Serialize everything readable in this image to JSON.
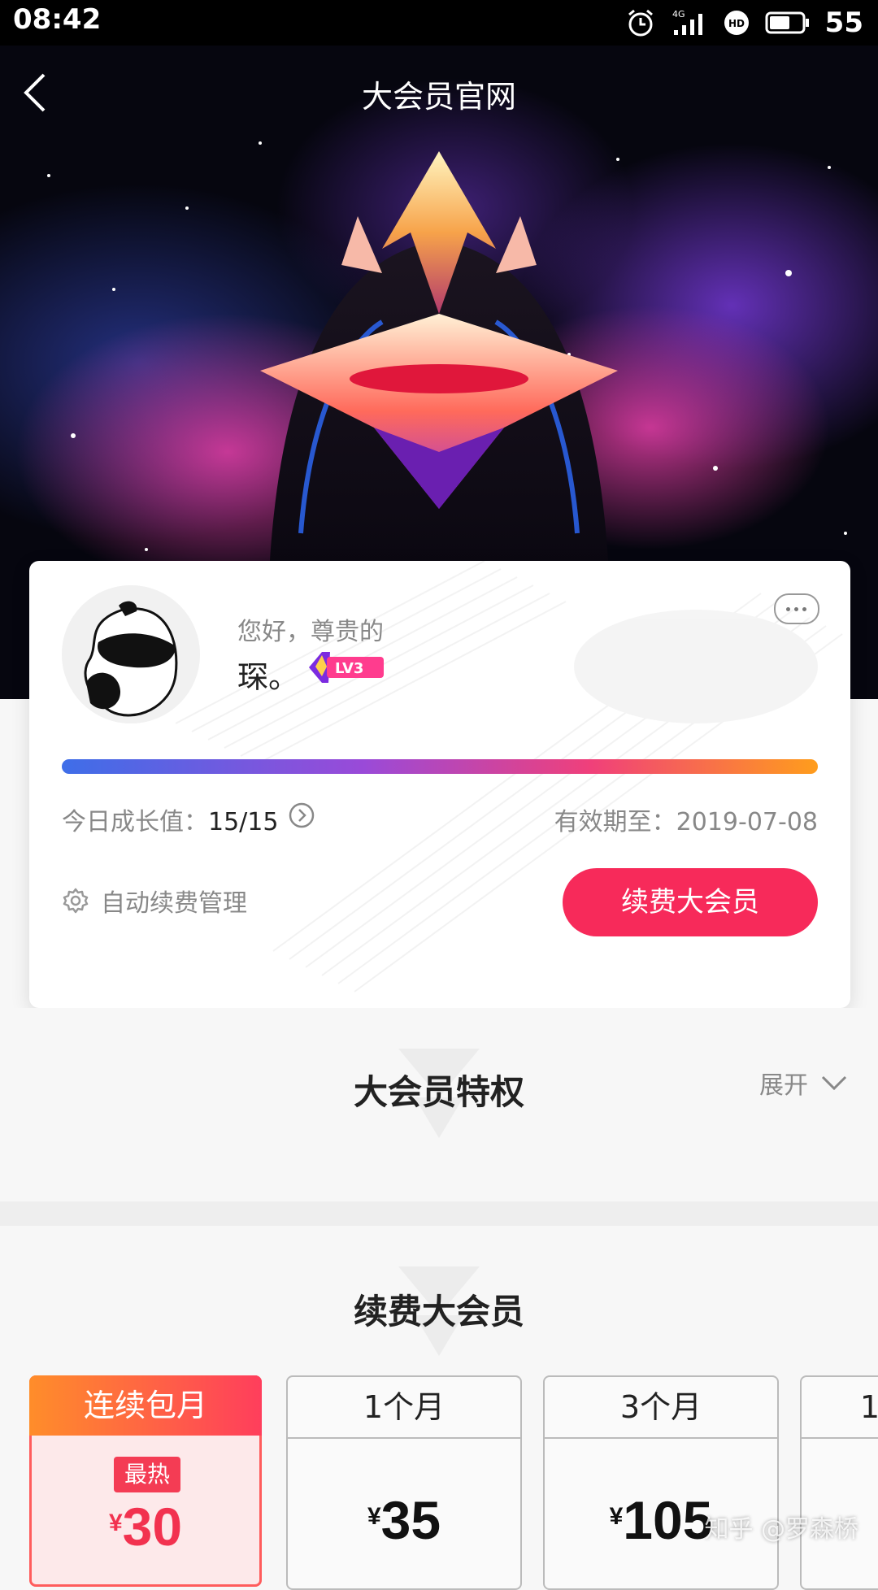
{
  "status_bar": {
    "time": "08:42",
    "network": "4G",
    "battery": "55"
  },
  "nav": {
    "title": "大会员官网",
    "back_icon": "chevron-left-icon"
  },
  "member_card": {
    "greeting": "您好，尊贵的",
    "username": "琛。",
    "level_badge": "LV3",
    "growth_label": "今日成长值：",
    "growth_value": "15/15",
    "expiry_label": "有效期至：",
    "expiry_date": "2019-07-08",
    "auto_renew_label": "自动续费管理",
    "renew_button": "续费大会员",
    "progress_fraction": 1.0
  },
  "privileges": {
    "title": "大会员特权",
    "expand_label": "展开"
  },
  "renew_section": {
    "title": "续费大会员",
    "plans": [
      {
        "name": "连续包月",
        "badge": "最热",
        "currency": "¥",
        "price": "30",
        "featured": true
      },
      {
        "name": "1个月",
        "currency": "¥",
        "price": "35"
      },
      {
        "name": "3个月",
        "currency": "¥",
        "price": "105"
      },
      {
        "name": "1"
      }
    ]
  },
  "watermark": "知乎 @罗森桥",
  "colors": {
    "accent": "#f72a5a",
    "progress_start": "#3e6ee8",
    "progress_end": "#ff9d1c"
  }
}
